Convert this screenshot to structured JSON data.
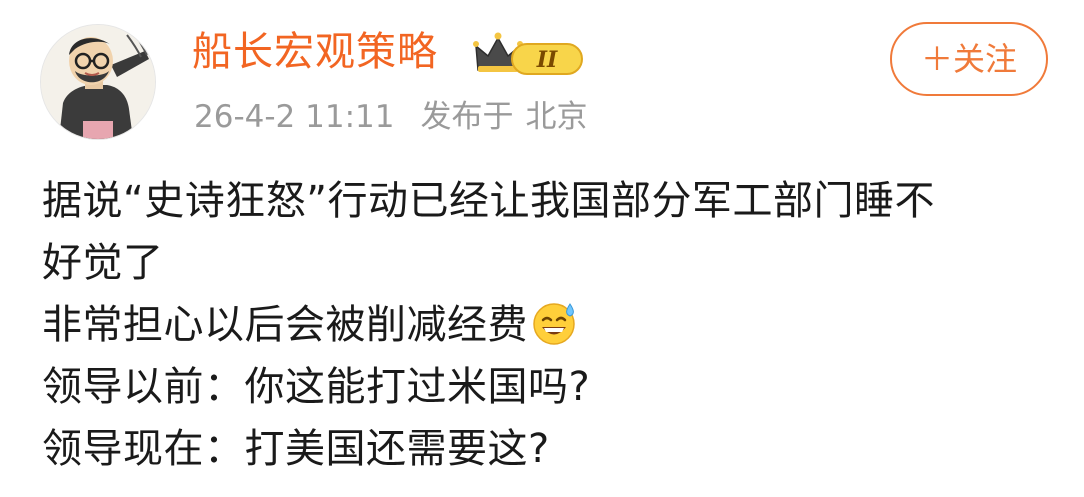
{
  "post": {
    "author": {
      "name": "船长宏观策略",
      "avatar_icon": "cartoon-man-avatar",
      "badge_icon": "crown-level-badge",
      "badge_text": "II"
    },
    "time": "26-4-2 11:11",
    "location_prefix": "发布于",
    "location": "北京",
    "follow_label": "＋关注",
    "content_lines": [
      "据说“史诗狂怒”行动已经让我国部分军工部门睡不",
      "好觉了",
      "非常担心以后会被削减经费",
      "领导以前：你这能打过米国吗?",
      "领导现在：打美国还需要这?"
    ],
    "emoji_icon": "sweat-smile-emoji",
    "colors": {
      "username": "#f26522",
      "follow": "#f07a3a",
      "meta": "#9a9a9a",
      "text": "#1a1a1a"
    }
  }
}
